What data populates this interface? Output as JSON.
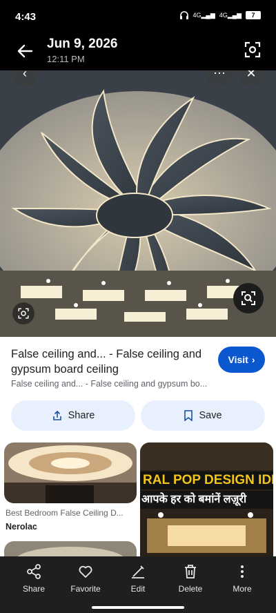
{
  "status_bar": {
    "time": "4:43",
    "net1": "4G",
    "net2": "4G",
    "battery": "7"
  },
  "header": {
    "date": "Jun 9, 2026",
    "time": "12:11 PM"
  },
  "detail": {
    "title": "False ceiling and... - False ceiling and gypsum board ceiling",
    "subtitle": "False ceiling and... - False ceiling and gypsum bo...",
    "visit_label": "Visit",
    "share_label": "Share",
    "save_label": "Save"
  },
  "related": {
    "left_title": "Best Bedroom False Ceiling D...",
    "left_source": "Nerolac",
    "right_text1": "RAL POP DESIGN IDE",
    "right_text2": "आपके हर को बमांनें लज़ूरी"
  },
  "bottom_nav": [
    {
      "label": "Share",
      "icon": "share-icon"
    },
    {
      "label": "Favorite",
      "icon": "heart-icon"
    },
    {
      "label": "Edit",
      "icon": "edit-icon"
    },
    {
      "label": "Delete",
      "icon": "trash-icon"
    },
    {
      "label": "More",
      "icon": "more-vertical-icon"
    }
  ],
  "colors": {
    "accent": "#0b57d0",
    "pill_bg": "#e8f0fe",
    "bar_bg": "#1f1f1f"
  }
}
